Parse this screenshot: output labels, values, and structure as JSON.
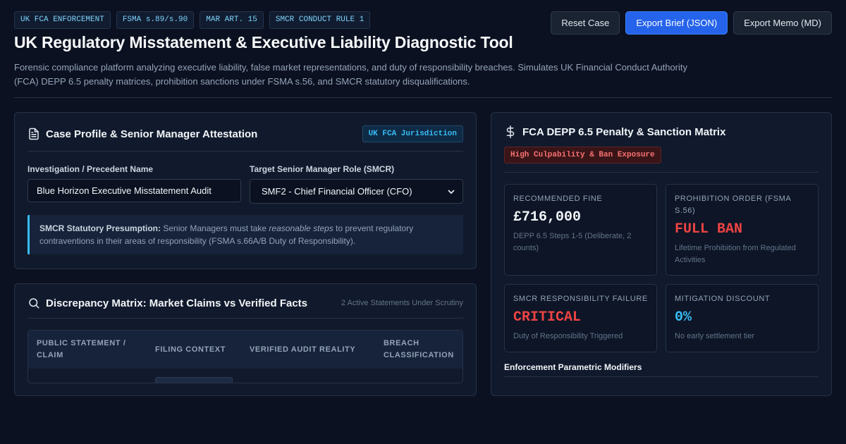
{
  "colors": {
    "background": "#0b1120",
    "card": "#111a2c",
    "accent": "#38bdf8",
    "primary_button": "#2563eb",
    "danger": "#f87171",
    "info": "#38bdf8"
  },
  "header": {
    "tags": [
      "UK FCA ENFORCEMENT",
      "FSMA s.89/s.90",
      "MAR ART. 15",
      "SMCR CONDUCT RULE 1"
    ],
    "title": "UK Regulatory Misstatement & Executive Liability Diagnostic Tool",
    "subtitle": "Forensic compliance platform analyzing executive liability, false market representations, and duty of responsibility breaches. Simulates UK Financial Conduct Authority (FCA) DEPP 6.5 penalty matrices, prohibition sanctions under FSMA s.56, and SMCR statutory disqualifications.",
    "actions": {
      "reset": "Reset Case",
      "export_json": "Export Brief (JSON)",
      "export_md": "Export Memo (MD)"
    }
  },
  "case_profile": {
    "icon": "document-icon",
    "title": "Case Profile & Senior Manager Attestation",
    "jurisdiction_badge": "UK FCA Jurisdiction",
    "investigation_label": "Investigation / Precedent Name",
    "investigation_value": "Blue Horizon Executive Misstatement Audit",
    "role_label": "Target Senior Manager Role (SMCR)",
    "role_value": "SMF2 - Chief Financial Officer (CFO)",
    "callout": {
      "lead": "SMCR Statutory Presumption:",
      "text_before": " Senior Managers must take ",
      "emphasis": "reasonable steps",
      "text_after": " to prevent regulatory contraventions in their areas of responsibility (FSMA s.66A/B Duty of Responsibility)."
    }
  },
  "discrepancy": {
    "icon": "search-icon",
    "title": "Discrepancy Matrix: Market Claims vs Verified Facts",
    "count_label": "2 Active Statements Under Scrutiny",
    "columns": [
      "PUBLIC STATEMENT / CLAIM",
      "FILING CONTEXT",
      "VERIFIED AUDIT REALITY",
      "BREACH CLASSIFICATION"
    ]
  },
  "penalty": {
    "icon": "dollar-icon",
    "title": "FCA DEPP 6.5 Penalty & Sanction Matrix",
    "risk_badge": "High Culpability & Ban Exposure",
    "metrics": [
      {
        "label": "RECOMMENDED FINE",
        "value": "£716,000",
        "note": "DEPP 6.5 Steps 1-5 (Deliberate, 2 counts)",
        "tone": "neutral"
      },
      {
        "label": "PROHIBITION ORDER (FSMA S.56)",
        "value": "FULL BAN",
        "note": "Lifetime Prohibition from Regulated Activities",
        "tone": "danger"
      },
      {
        "label": "SMCR RESPONSIBILITY FAILURE",
        "value": "CRITICAL",
        "note": "Duty of Responsibility Triggered",
        "tone": "danger"
      },
      {
        "label": "MITIGATION DISCOUNT",
        "value": "0%",
        "note": "No early settlement tier",
        "tone": "info"
      }
    ],
    "modifiers_title": "Enforcement Parametric Modifiers"
  }
}
